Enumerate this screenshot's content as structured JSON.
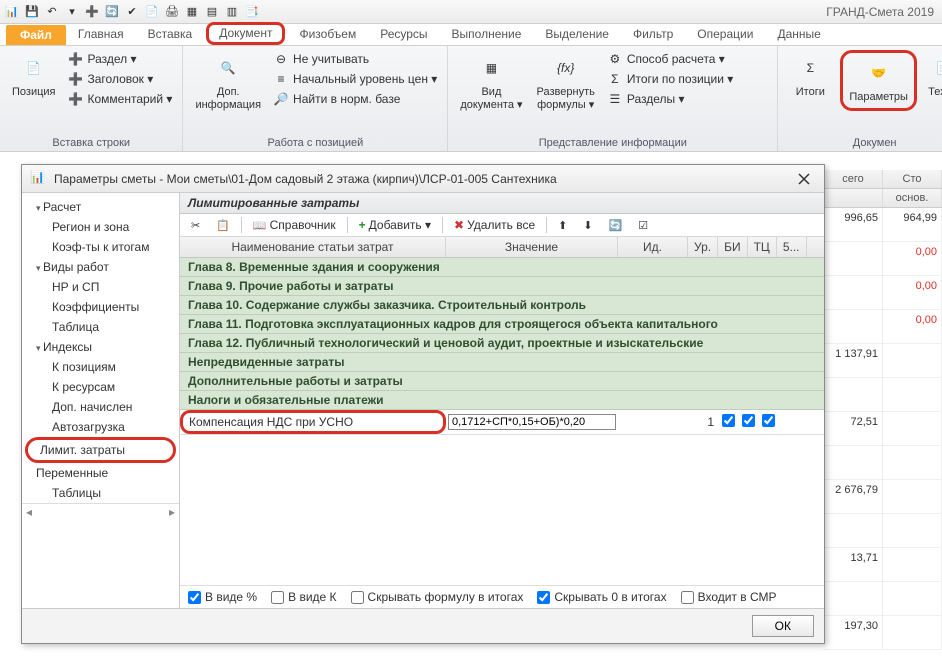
{
  "app_title": "ГРАНД-Смета 2019",
  "qat_icons": [
    "app-icon",
    "save-icon",
    "undo-icon",
    "redo-icon",
    "refresh-icon",
    "spellcheck-icon",
    "find-icon",
    "chart-icon",
    "table-icon",
    "layout-icon",
    "print-icon"
  ],
  "tabs": {
    "file": "Файл",
    "items": [
      "Главная",
      "Вставка",
      "Документ",
      "Физобъем",
      "Ресурсы",
      "Выполнение",
      "Выделение",
      "Фильтр",
      "Операции",
      "Данные"
    ],
    "highlight_index": 2
  },
  "ribbon": {
    "group_insert": {
      "label": "Вставка строки",
      "position": "Позиция",
      "items": [
        "Раздел ▾",
        "Заголовок ▾",
        "Комментарий ▾"
      ]
    },
    "group_work": {
      "label": "Работа с позицией",
      "extra_button": "Доп.\nинформация",
      "items": [
        "Не учитывать",
        "Начальный уровень цен ▾",
        "Найти в норм. базе"
      ]
    },
    "group_view": {
      "label": "Представление информации",
      "view": "Вид\nдокумента ▾",
      "expand": "Развернуть\nформулы ▾",
      "items": [
        "Способ расчета ▾",
        "Итоги по позиции ▾",
        "Разделы ▾"
      ]
    },
    "group_doc": {
      "label": "Докумен",
      "totals": "Итоги",
      "params": "Параметры",
      "tech": "Техни"
    }
  },
  "dialog": {
    "title": "Параметры сметы - Мои сметы\\01-Дом садовый 2 этажа (кирпич)\\ЛСР-01-005 Сантехника",
    "tree": [
      {
        "label": "Расчет",
        "level": 1,
        "state": "exp"
      },
      {
        "label": "Регион и зона",
        "level": 2
      },
      {
        "label": "Коэф-ты к итогам",
        "level": 2
      },
      {
        "label": "Виды работ",
        "level": 1,
        "state": "exp"
      },
      {
        "label": "НР и СП",
        "level": 2
      },
      {
        "label": "Коэффициенты",
        "level": 2
      },
      {
        "label": "Таблица",
        "level": 2
      },
      {
        "label": "Индексы",
        "level": 1,
        "state": "exp"
      },
      {
        "label": "К позициям",
        "level": 2
      },
      {
        "label": "К ресурсам",
        "level": 2
      },
      {
        "label": "Доп. начислен",
        "level": 2
      },
      {
        "label": "Автозагрузка",
        "level": 2
      },
      {
        "label": "Лимит. затраты",
        "level": 1,
        "highlight": true
      },
      {
        "label": "Переменные",
        "level": 1
      },
      {
        "label": "Таблицы",
        "level": 2
      }
    ],
    "panel_header": "Лимитированные затраты",
    "toolbar": {
      "ref": "Справочник",
      "add": "Добавить ▾",
      "del": "Удалить все"
    },
    "columns": {
      "name": "Наименование статьи затрат",
      "value": "Значение",
      "id": "Ид.",
      "ur": "Ур.",
      "bi": "БИ",
      "tc": "ТЦ",
      "x": "5..."
    },
    "chapters": [
      "Глава 8. Временные здания и сооружения",
      "Глава 9. Прочие работы и затраты",
      "Глава 10. Содержание службы заказчика. Строительный контроль",
      "Глава 11. Подготовка эксплуатационных кадров для строящегося объекта капитального",
      "Глава 12. Публичный технологический и ценовой аудит, проектные и изыскательские",
      "Непредвиденные затраты",
      "Дополнительные работы и затраты",
      "Налоги и обязательные платежи"
    ],
    "row": {
      "name": "Компенсация НДС при УСНО",
      "value": "0,1712+СП*0,15+ОБ)*0,20",
      "ur": "1"
    },
    "options": [
      "В виде %",
      "В виде К",
      "Скрывать формулу в итогах",
      "Скрывать 0 в итогах",
      "Входит в СМР"
    ],
    "option_checked": [
      true,
      false,
      false,
      true,
      false
    ],
    "ok": "ОК"
  },
  "bg_grid": {
    "cols": [
      "сего",
      "Сто"
    ],
    "sub": [
      "",
      "основ."
    ],
    "rows": [
      [
        "996,65",
        "964,99"
      ],
      [
        "",
        "0,00"
      ],
      [
        "",
        "0,00"
      ],
      [
        "",
        "0,00"
      ],
      [
        "1 137,91",
        ""
      ],
      [
        "",
        ""
      ],
      [
        "72,51",
        ""
      ],
      [
        "",
        ""
      ],
      [
        "2 676,79",
        ""
      ],
      [
        "",
        ""
      ],
      [
        "13,71",
        ""
      ],
      [
        "",
        ""
      ],
      [
        "197,30",
        ""
      ]
    ],
    "red_rows": [
      1,
      2,
      3
    ]
  }
}
